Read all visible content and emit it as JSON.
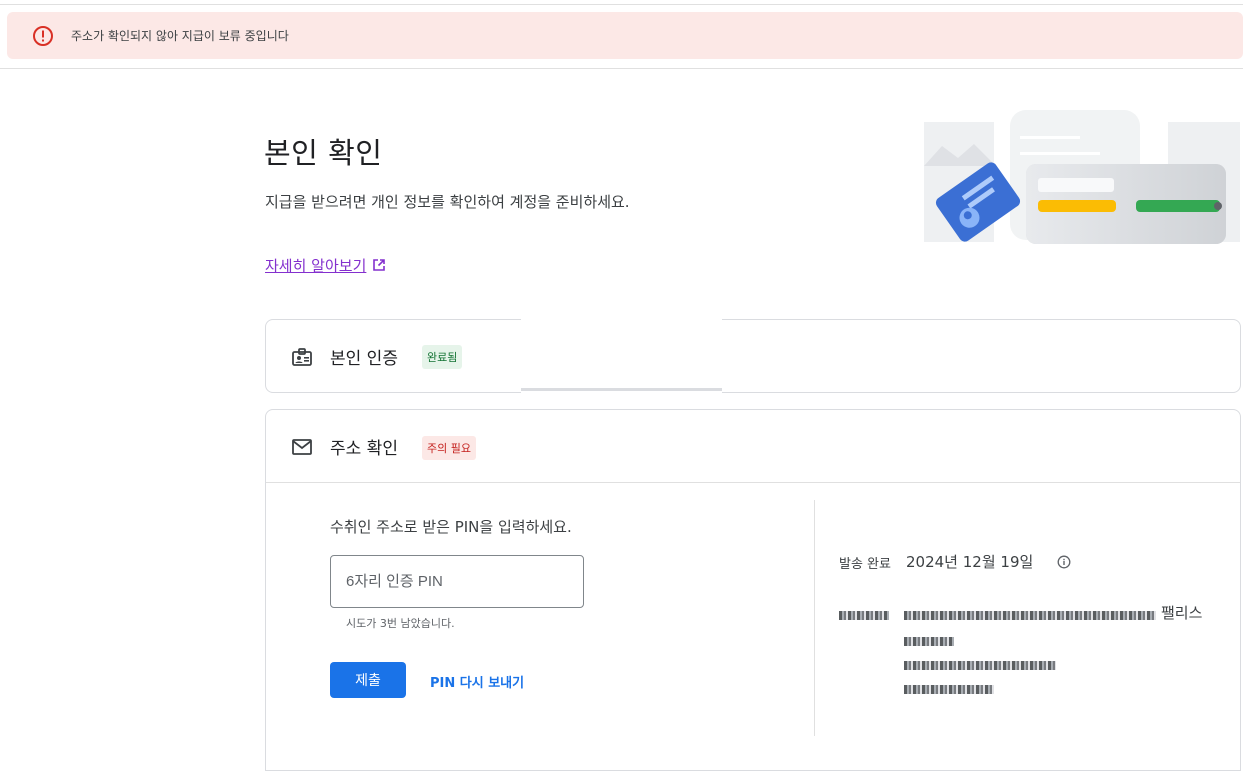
{
  "alert": {
    "icon": "error-icon",
    "color": "#d93025",
    "text": "주소가 확인되지 않아 지급이 보류 중입니다"
  },
  "header": {
    "title": "본인 확인",
    "description": "지급을 받으려면 개인 정보를 확인하여 계정을 준비하세요.",
    "learn_more": "자세히 알아보기"
  },
  "identity_card": {
    "icon": "id-badge-icon",
    "title": "본인 인증",
    "badge": "완료됨"
  },
  "address_card": {
    "icon": "mail-icon",
    "title": "주소 확인",
    "badge": "주의 필요",
    "pin_prompt": "수취인 주소로 받은 PIN을 입력하세요.",
    "pin_placeholder": "6자리 인증 PIN",
    "attempts": "시도가 3번 남았습니다.",
    "submit_label": "제출",
    "resend_label": "PIN 다시 보내기",
    "sent_label": "발송 완료",
    "sent_date": "2024년 12월 19일",
    "address_suffix": "팰리스"
  },
  "colors": {
    "accent": "#1a73e8",
    "success_bg": "#e6f4ea",
    "warn_bg": "#fce8e6",
    "alert_bg": "#fce8e6"
  }
}
